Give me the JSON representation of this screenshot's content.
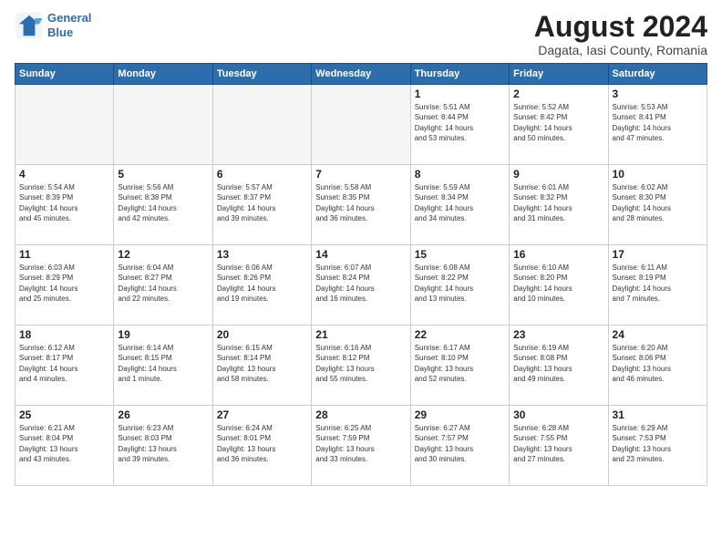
{
  "header": {
    "logo_line1": "General",
    "logo_line2": "Blue",
    "main_title": "August 2024",
    "subtitle": "Dagata, Iasi County, Romania"
  },
  "days_of_week": [
    "Sunday",
    "Monday",
    "Tuesday",
    "Wednesday",
    "Thursday",
    "Friday",
    "Saturday"
  ],
  "weeks": [
    [
      {
        "day": "",
        "empty": true
      },
      {
        "day": "",
        "empty": true
      },
      {
        "day": "",
        "empty": true
      },
      {
        "day": "",
        "empty": true
      },
      {
        "day": "1",
        "info": "Sunrise: 5:51 AM\nSunset: 8:44 PM\nDaylight: 14 hours\nand 53 minutes."
      },
      {
        "day": "2",
        "info": "Sunrise: 5:52 AM\nSunset: 8:42 PM\nDaylight: 14 hours\nand 50 minutes."
      },
      {
        "day": "3",
        "info": "Sunrise: 5:53 AM\nSunset: 8:41 PM\nDaylight: 14 hours\nand 47 minutes."
      }
    ],
    [
      {
        "day": "4",
        "info": "Sunrise: 5:54 AM\nSunset: 8:39 PM\nDaylight: 14 hours\nand 45 minutes."
      },
      {
        "day": "5",
        "info": "Sunrise: 5:56 AM\nSunset: 8:38 PM\nDaylight: 14 hours\nand 42 minutes."
      },
      {
        "day": "6",
        "info": "Sunrise: 5:57 AM\nSunset: 8:37 PM\nDaylight: 14 hours\nand 39 minutes."
      },
      {
        "day": "7",
        "info": "Sunrise: 5:58 AM\nSunset: 8:35 PM\nDaylight: 14 hours\nand 36 minutes."
      },
      {
        "day": "8",
        "info": "Sunrise: 5:59 AM\nSunset: 8:34 PM\nDaylight: 14 hours\nand 34 minutes."
      },
      {
        "day": "9",
        "info": "Sunrise: 6:01 AM\nSunset: 8:32 PM\nDaylight: 14 hours\nand 31 minutes."
      },
      {
        "day": "10",
        "info": "Sunrise: 6:02 AM\nSunset: 8:30 PM\nDaylight: 14 hours\nand 28 minutes."
      }
    ],
    [
      {
        "day": "11",
        "info": "Sunrise: 6:03 AM\nSunset: 8:29 PM\nDaylight: 14 hours\nand 25 minutes."
      },
      {
        "day": "12",
        "info": "Sunrise: 6:04 AM\nSunset: 8:27 PM\nDaylight: 14 hours\nand 22 minutes."
      },
      {
        "day": "13",
        "info": "Sunrise: 6:06 AM\nSunset: 8:26 PM\nDaylight: 14 hours\nand 19 minutes."
      },
      {
        "day": "14",
        "info": "Sunrise: 6:07 AM\nSunset: 8:24 PM\nDaylight: 14 hours\nand 16 minutes."
      },
      {
        "day": "15",
        "info": "Sunrise: 6:08 AM\nSunset: 8:22 PM\nDaylight: 14 hours\nand 13 minutes."
      },
      {
        "day": "16",
        "info": "Sunrise: 6:10 AM\nSunset: 8:20 PM\nDaylight: 14 hours\nand 10 minutes."
      },
      {
        "day": "17",
        "info": "Sunrise: 6:11 AM\nSunset: 8:19 PM\nDaylight: 14 hours\nand 7 minutes."
      }
    ],
    [
      {
        "day": "18",
        "info": "Sunrise: 6:12 AM\nSunset: 8:17 PM\nDaylight: 14 hours\nand 4 minutes."
      },
      {
        "day": "19",
        "info": "Sunrise: 6:14 AM\nSunset: 8:15 PM\nDaylight: 14 hours\nand 1 minute."
      },
      {
        "day": "20",
        "info": "Sunrise: 6:15 AM\nSunset: 8:14 PM\nDaylight: 13 hours\nand 58 minutes."
      },
      {
        "day": "21",
        "info": "Sunrise: 6:16 AM\nSunset: 8:12 PM\nDaylight: 13 hours\nand 55 minutes."
      },
      {
        "day": "22",
        "info": "Sunrise: 6:17 AM\nSunset: 8:10 PM\nDaylight: 13 hours\nand 52 minutes."
      },
      {
        "day": "23",
        "info": "Sunrise: 6:19 AM\nSunset: 8:08 PM\nDaylight: 13 hours\nand 49 minutes."
      },
      {
        "day": "24",
        "info": "Sunrise: 6:20 AM\nSunset: 8:06 PM\nDaylight: 13 hours\nand 46 minutes."
      }
    ],
    [
      {
        "day": "25",
        "info": "Sunrise: 6:21 AM\nSunset: 8:04 PM\nDaylight: 13 hours\nand 43 minutes."
      },
      {
        "day": "26",
        "info": "Sunrise: 6:23 AM\nSunset: 8:03 PM\nDaylight: 13 hours\nand 39 minutes."
      },
      {
        "day": "27",
        "info": "Sunrise: 6:24 AM\nSunset: 8:01 PM\nDaylight: 13 hours\nand 36 minutes."
      },
      {
        "day": "28",
        "info": "Sunrise: 6:25 AM\nSunset: 7:59 PM\nDaylight: 13 hours\nand 33 minutes."
      },
      {
        "day": "29",
        "info": "Sunrise: 6:27 AM\nSunset: 7:57 PM\nDaylight: 13 hours\nand 30 minutes."
      },
      {
        "day": "30",
        "info": "Sunrise: 6:28 AM\nSunset: 7:55 PM\nDaylight: 13 hours\nand 27 minutes."
      },
      {
        "day": "31",
        "info": "Sunrise: 6:29 AM\nSunset: 7:53 PM\nDaylight: 13 hours\nand 23 minutes."
      }
    ]
  ]
}
